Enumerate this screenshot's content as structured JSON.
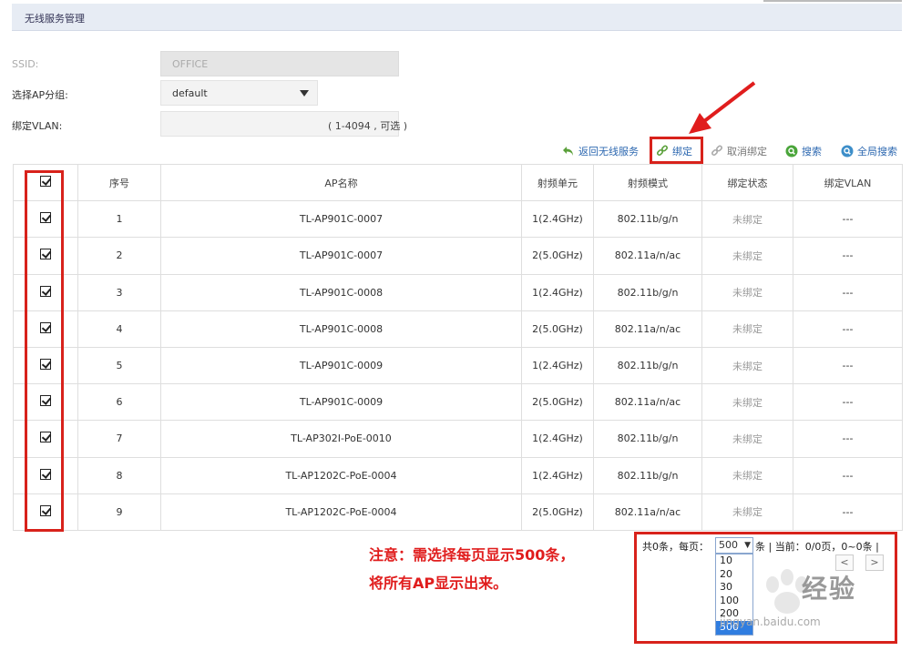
{
  "header": {
    "title": "无线服务管理"
  },
  "form": {
    "ssid_label": "SSID:",
    "ssid_value": "OFFICE",
    "ap_group_label": "选择AP分组:",
    "ap_group_value": "default",
    "vlan_label": "绑定VLAN:",
    "vlan_value": "",
    "vlan_hint": "( 1-4094 , 可选 )"
  },
  "toolbar": {
    "back_label": "返回无线服务",
    "bind_label": "绑定",
    "unbind_label": "取消绑定",
    "search_label": "搜索",
    "global_search_label": "全局搜索"
  },
  "table": {
    "columns": [
      "序号",
      "AP名称",
      "射频单元",
      "射频模式",
      "绑定状态",
      "绑定VLAN"
    ],
    "rows": [
      {
        "index": "1",
        "name": "TL-AP901C-0007",
        "radio": "1(2.4GHz)",
        "mode": "802.11b/g/n",
        "status": "未绑定",
        "vlan": "---"
      },
      {
        "index": "2",
        "name": "TL-AP901C-0007",
        "radio": "2(5.0GHz)",
        "mode": "802.11a/n/ac",
        "status": "未绑定",
        "vlan": "---"
      },
      {
        "index": "3",
        "name": "TL-AP901C-0008",
        "radio": "1(2.4GHz)",
        "mode": "802.11b/g/n",
        "status": "未绑定",
        "vlan": "---"
      },
      {
        "index": "4",
        "name": "TL-AP901C-0008",
        "radio": "2(5.0GHz)",
        "mode": "802.11a/n/ac",
        "status": "未绑定",
        "vlan": "---"
      },
      {
        "index": "5",
        "name": "TL-AP901C-0009",
        "radio": "1(2.4GHz)",
        "mode": "802.11b/g/n",
        "status": "未绑定",
        "vlan": "---"
      },
      {
        "index": "6",
        "name": "TL-AP901C-0009",
        "radio": "2(5.0GHz)",
        "mode": "802.11a/n/ac",
        "status": "未绑定",
        "vlan": "---"
      },
      {
        "index": "7",
        "name": "TL-AP302I-PoE-0010",
        "radio": "1(2.4GHz)",
        "mode": "802.11b/g/n",
        "status": "未绑定",
        "vlan": "---"
      },
      {
        "index": "8",
        "name": "TL-AP1202C-PoE-0004",
        "radio": "1(2.4GHz)",
        "mode": "802.11b/g/n",
        "status": "未绑定",
        "vlan": "---"
      },
      {
        "index": "9",
        "name": "TL-AP1202C-PoE-0004",
        "radio": "2(5.0GHz)",
        "mode": "802.11a/n/ac",
        "status": "未绑定",
        "vlan": "---"
      }
    ]
  },
  "note": {
    "line1": "注意：需选择每页显示500条，",
    "line2": "将所有AP显示出来。"
  },
  "pager": {
    "total_label": "共0条，每页：",
    "per_page": "500",
    "suffix": "条 | 当前：0/0页，0~0条 |",
    "options": [
      "10",
      "20",
      "30",
      "100",
      "200",
      "500"
    ],
    "selected": "500",
    "prev": "<",
    "next": ">"
  },
  "watermark": {
    "brand": "经验",
    "url": "jingyan.baidu.com"
  },
  "colors": {
    "highlight": "#d8221b",
    "link": "#2d68b0",
    "dropdown_selected": "#2f7de0"
  },
  "icons": {
    "back": "return-arrow-icon",
    "bind": "link-icon",
    "unbind": "unlink-icon",
    "search": "search-icon",
    "global_search": "global-search-icon"
  }
}
